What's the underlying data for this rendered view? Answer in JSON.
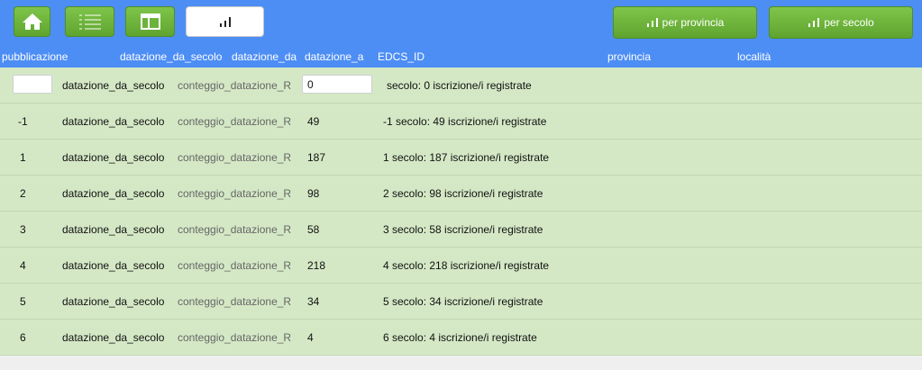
{
  "toolbar": {
    "home_icon": "home-icon",
    "list_icon": "list-icon",
    "layout_icon": "layout-icon",
    "chart_icon": "bar-chart-icon",
    "per_provincia_label": "per provincia",
    "per_secolo_label": "per secolo"
  },
  "columns": {
    "pubblicazione": "pubblicazione",
    "datazione_da_secolo": "datazione_da_secolo",
    "datazione_da": "datazione_da",
    "datazione_a": "datazione_a",
    "edcs_id": "EDCS_ID",
    "provincia": "provincia",
    "localita": "località"
  },
  "filter_row": {
    "pubblicazione_value": "",
    "datazione_da_secolo": "datazione_da_secolo",
    "conteggio": "conteggio_datazione_R",
    "datazione_a_value": "0",
    "summary": "secolo: 0 iscrizione/i registrate"
  },
  "rows": [
    {
      "secolo": "-1",
      "field": "datazione_da_secolo",
      "count_field": "conteggio_datazione_R",
      "count": "49",
      "summary": "-1 secolo: 49 iscrizione/i registrate"
    },
    {
      "secolo": "1",
      "field": "datazione_da_secolo",
      "count_field": "conteggio_datazione_R",
      "count": "187",
      "summary": "1 secolo: 187 iscrizione/i registrate"
    },
    {
      "secolo": "2",
      "field": "datazione_da_secolo",
      "count_field": "conteggio_datazione_R",
      "count": "98",
      "summary": "2 secolo: 98 iscrizione/i registrate"
    },
    {
      "secolo": "3",
      "field": "datazione_da_secolo",
      "count_field": "conteggio_datazione_R",
      "count": "58",
      "summary": "3 secolo: 58 iscrizione/i registrate"
    },
    {
      "secolo": "4",
      "field": "datazione_da_secolo",
      "count_field": "conteggio_datazione_R",
      "count": "218",
      "summary": "4 secolo: 218 iscrizione/i registrate"
    },
    {
      "secolo": "5",
      "field": "datazione_da_secolo",
      "count_field": "conteggio_datazione_R",
      "count": "34",
      "summary": "5 secolo: 34 iscrizione/i registrate"
    },
    {
      "secolo": "6",
      "field": "datazione_da_secolo",
      "count_field": "conteggio_datazione_R",
      "count": "4",
      "summary": "6 secolo: 4 iscrizione/i registrate"
    }
  ],
  "colors": {
    "topbar": "#4d8ef5",
    "button_green": "#6cb33c",
    "row_bg": "#d4e8c5",
    "page_bg": "#efefef"
  }
}
